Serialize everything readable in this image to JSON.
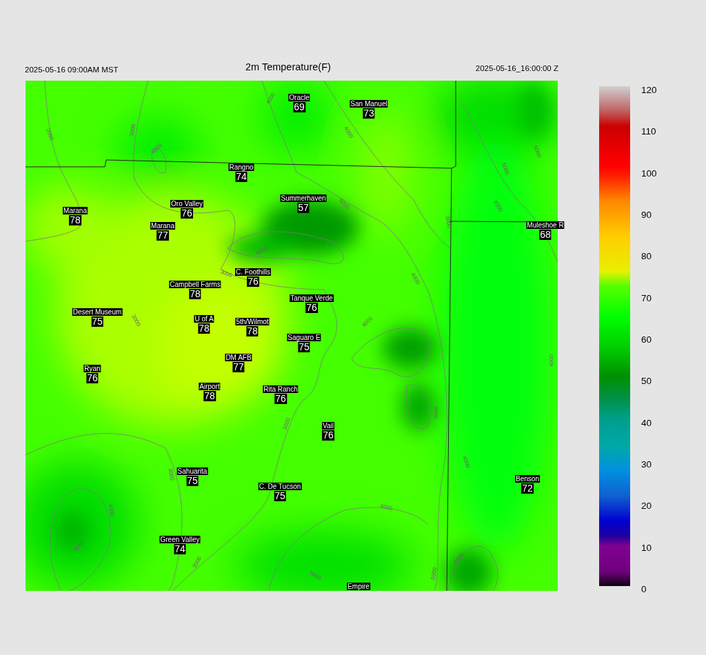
{
  "header": {
    "valid_time_local": "2025-05-16 09:00AM MST",
    "title": "2m Temperature(F)",
    "valid_time_utc": "2025-05-16_16:00:00 Z"
  },
  "map": {
    "stations": [
      {
        "name": "Oracle",
        "value": "69"
      },
      {
        "name": "San Manuel",
        "value": "73"
      },
      {
        "name": "Rangno",
        "value": "74"
      },
      {
        "name": "Summerhaven",
        "value": "57"
      },
      {
        "name": "Marana",
        "value": "78"
      },
      {
        "name": "Oro Valley",
        "value": "76"
      },
      {
        "name": "Marana",
        "value": "77"
      },
      {
        "name": "Muleshoe R",
        "value": "68"
      },
      {
        "name": "C. Foothills",
        "value": "76"
      },
      {
        "name": "Campbell Farms",
        "value": "78"
      },
      {
        "name": "Tanque Verde",
        "value": "76"
      },
      {
        "name": "Desert Museum",
        "value": "75"
      },
      {
        "name": "U of A",
        "value": "78"
      },
      {
        "name": "5th/Wilmot",
        "value": "78"
      },
      {
        "name": "Saguaro E",
        "value": "75"
      },
      {
        "name": "DM AFB",
        "value": "77"
      },
      {
        "name": "Ryan",
        "value": "76"
      },
      {
        "name": "Airport",
        "value": "78"
      },
      {
        "name": "Rita Ranch",
        "value": "76"
      },
      {
        "name": "Vail",
        "value": "76"
      },
      {
        "name": "Sahuarita",
        "value": "75"
      },
      {
        "name": "C. De Tucson",
        "value": "75"
      },
      {
        "name": "Benson",
        "value": "72"
      },
      {
        "name": "Green Valley",
        "value": "74"
      },
      {
        "name": "Empire"
      }
    ],
    "contour_labels": [
      "2000",
      "3000",
      "4000",
      "4000",
      "4000",
      "5000",
      "6000",
      "3000",
      "3000",
      "5000",
      "6000",
      "4000",
      "4000",
      "4000",
      "3000",
      "3000",
      "3000",
      "4000",
      "5000",
      "3000",
      "4000",
      "5000",
      "5000",
      "6000",
      "5000",
      "4000",
      "4000"
    ]
  },
  "colorbar": {
    "ticks": [
      "120",
      "110",
      "100",
      "90",
      "80",
      "70",
      "60",
      "50",
      "40",
      "30",
      "20",
      "10",
      "0"
    ]
  }
}
